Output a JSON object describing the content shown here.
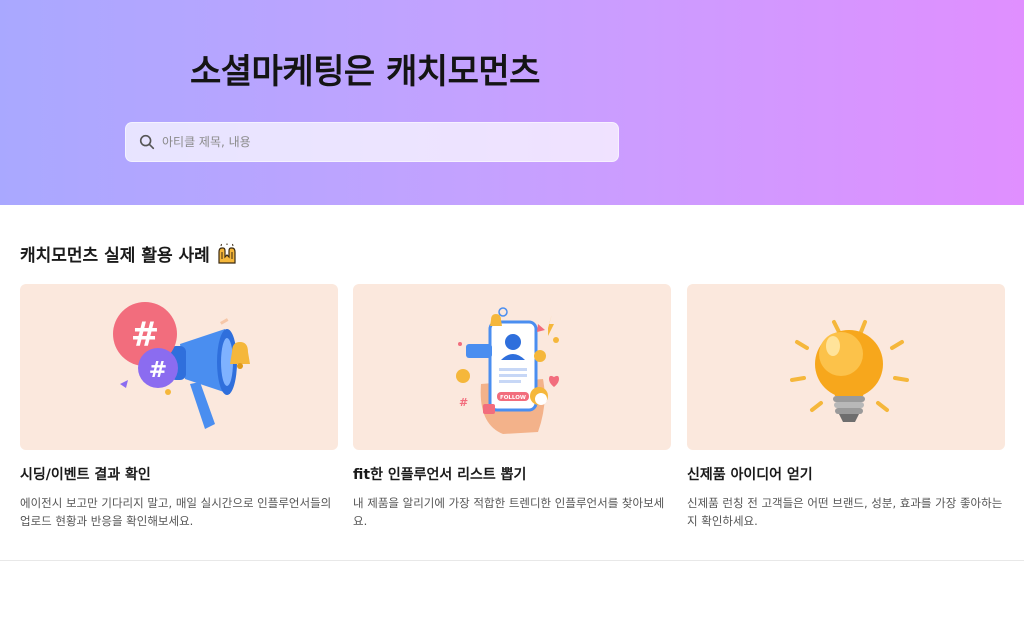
{
  "hero": {
    "title": "소셜마케팅은 캐치모먼츠",
    "search_placeholder": "아티클 제목, 내용",
    "gradient_colors": [
      "#a9a8ff",
      "#e08fff"
    ]
  },
  "section": {
    "title": "캐치모먼츠 실제 활용 사례",
    "title_icon": "raised-hands-icon"
  },
  "cards": [
    {
      "title": "시딩/이벤트 결과 확인",
      "description": "에이전시 보고만 기다리지 말고, 매일 실시간으로 인플루언서들의 업로드 현황과 반응을 확인해보세요.",
      "image_icon": "megaphone-hashtag-icon"
    },
    {
      "title": "fit한 인플루언서 리스트 뽑기",
      "description": "내 제품을 알리기에 가장 적합한 트렌디한 인플루언서를 찾아보세요.",
      "image_icon": "phone-follow-icon",
      "image_follow_text": "FOLLOW"
    },
    {
      "title": "신제품 아이디어 얻기",
      "description": "신제품 런칭 전 고객들은 어떤 브랜드, 성분, 효과를 가장 좋아하는지 확인하세요.",
      "image_icon": "lightbulb-icon"
    }
  ],
  "colors": {
    "card_bg": "#fbe8dd",
    "title_text": "#1a1a1a",
    "desc_text": "#555555"
  }
}
